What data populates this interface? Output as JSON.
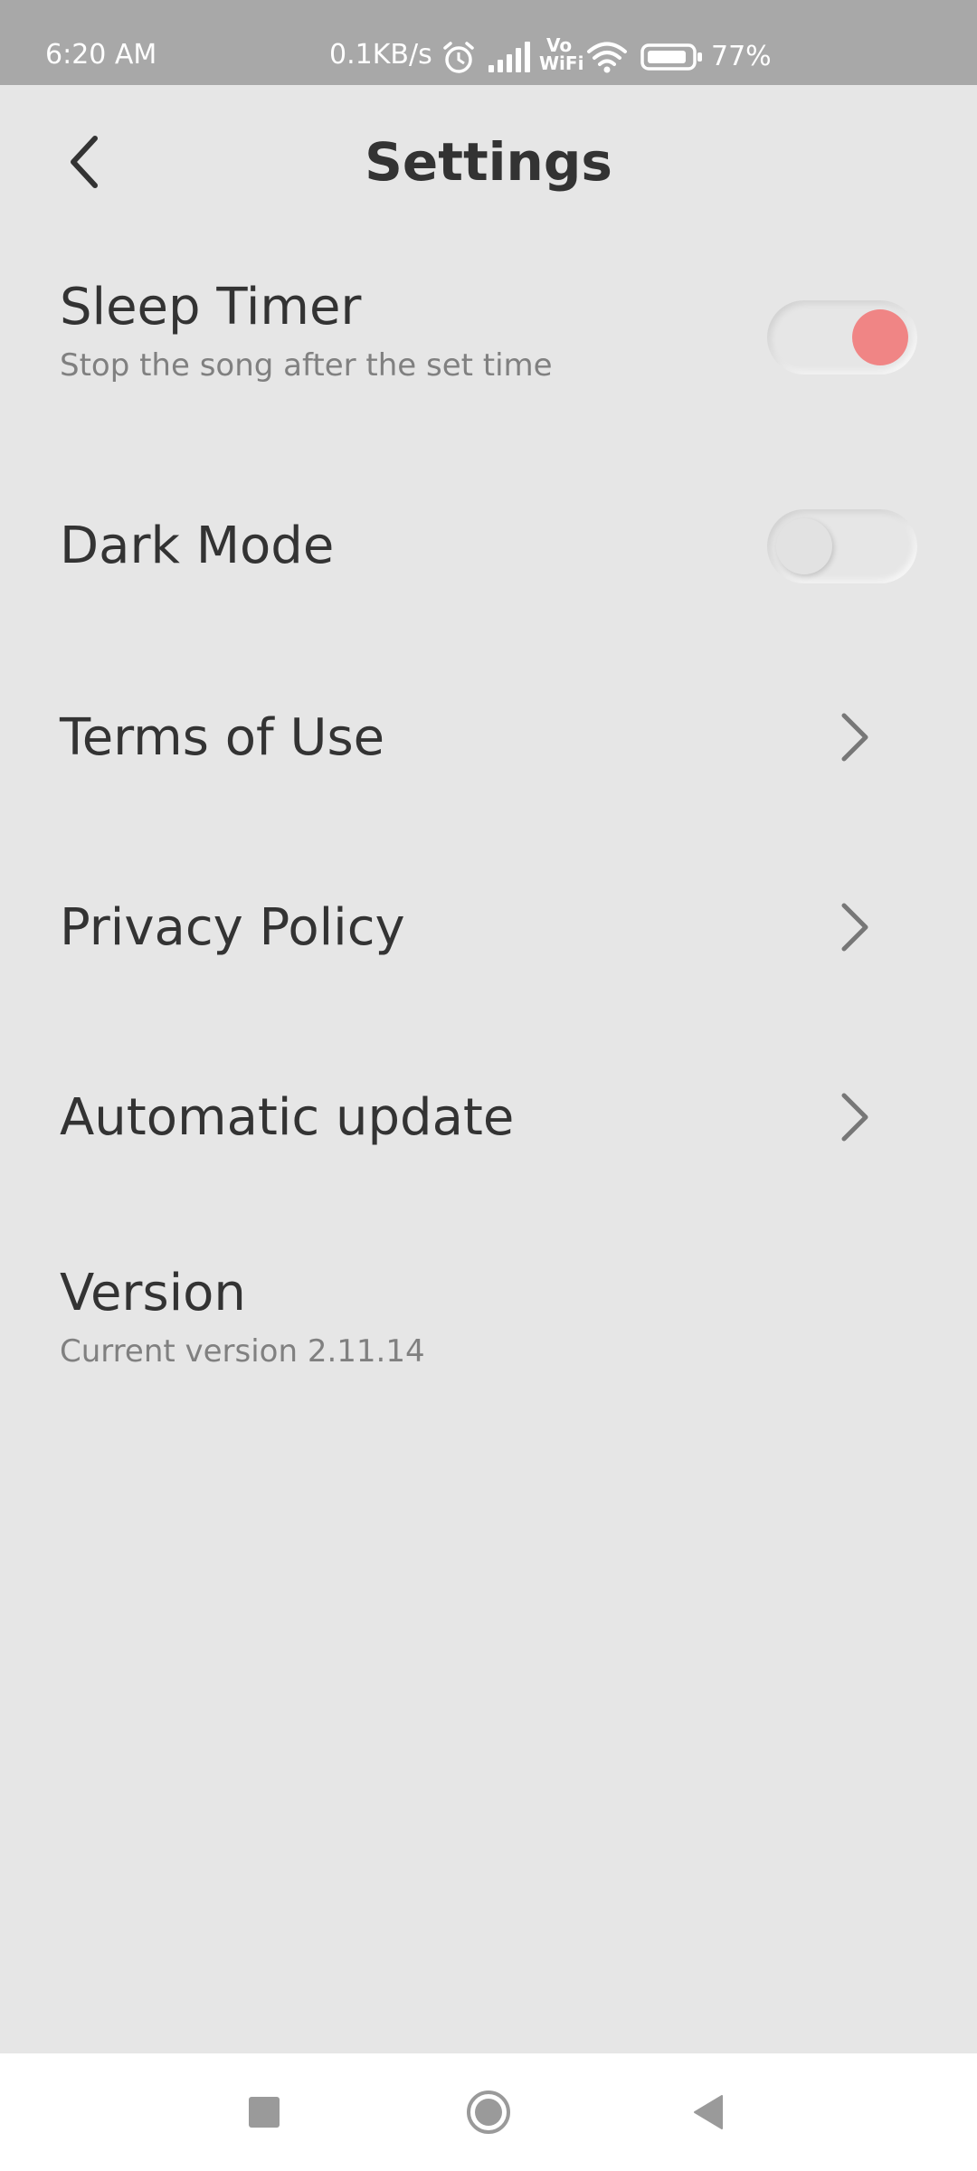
{
  "status_bar": {
    "time": "6:20 AM",
    "network_speed": "0.1KB/s",
    "battery": "77%",
    "icons": [
      "alarm-icon",
      "signal-icon",
      "vowifi-icon",
      "wifi-icon",
      "battery-icon"
    ],
    "vowifi_label_top": "Vo",
    "vowifi_label_bottom": "WiFi"
  },
  "header": {
    "title": "Settings",
    "back_icon": "chevron-left-icon"
  },
  "settings": {
    "sleep_timer": {
      "title": "Sleep Timer",
      "subtitle": "Stop the song after the set time",
      "enabled": true
    },
    "dark_mode": {
      "title": "Dark Mode",
      "enabled": false
    },
    "terms_of_use": {
      "title": "Terms of Use"
    },
    "privacy_policy": {
      "title": "Privacy Policy"
    },
    "automatic_update": {
      "title": "Automatic update"
    },
    "version": {
      "title": "Version",
      "subtitle": "Current version 2.11.14"
    }
  },
  "colors": {
    "background": "#e6e6e6",
    "status_bar": "#a8a8a8",
    "toggle_on_knob": "#f08585",
    "toggle_off_knob": "#e2e2e2",
    "text_primary": "#333333",
    "text_secondary": "#808080"
  },
  "nav_bar": {
    "icons": [
      "recents-square-icon",
      "home-circle-icon",
      "back-triangle-icon"
    ]
  }
}
